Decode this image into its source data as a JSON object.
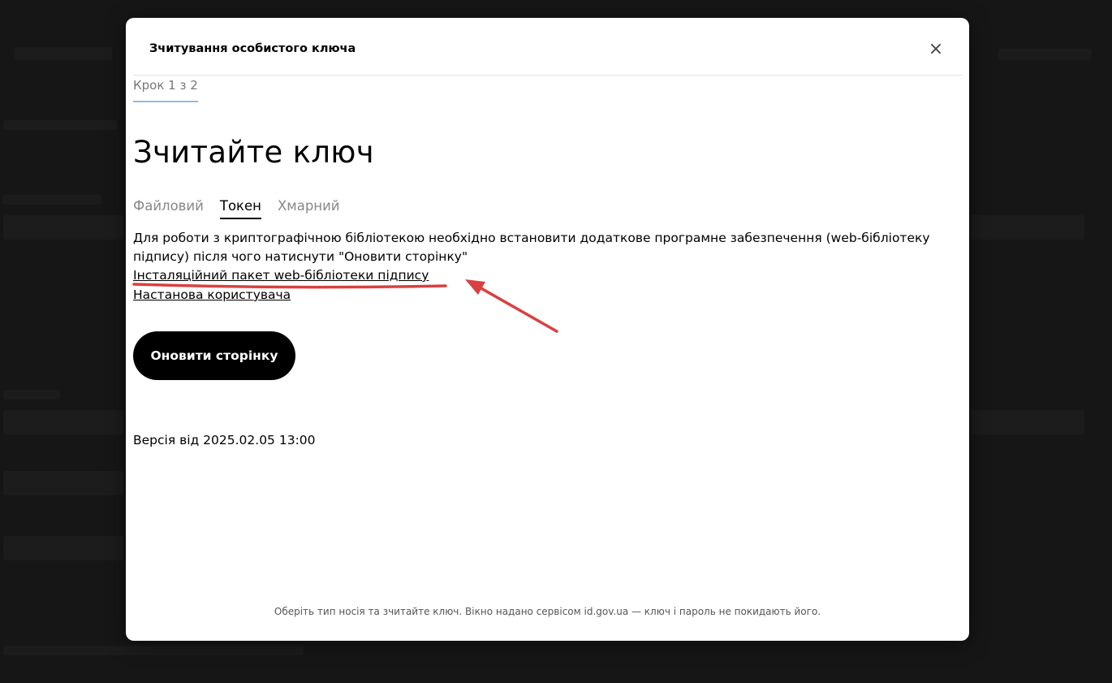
{
  "modal": {
    "title": "Зчитування особистого ключа",
    "close_symbol": "×",
    "step": "Крок 1 з 2",
    "heading": "Зчитайте ключ",
    "tabs": [
      {
        "label": "Файловий",
        "active": false
      },
      {
        "label": "Токен",
        "active": true
      },
      {
        "label": "Хмарний",
        "active": false
      }
    ],
    "description": "Для роботи з криптографічною бібліотекою необхідно встановити додаткове програмне забезпечення (web-бібліотеку підпису) після чого натиснути \"Оновити сторінку\"",
    "links": {
      "installer": "Інсталяційний пакет web-бібліотеки підпису",
      "manual": "Настанова користувача"
    },
    "refresh_button": "Оновити сторінку",
    "version": "Версія від 2025.02.05 13:00",
    "footer": "Оберіть тип носія та зчитайте ключ. Вікно надано сервісом id.gov.ua — ключ і пароль не покидають його."
  },
  "colors": {
    "annotation": "#d94040",
    "step_underline": "#93b9d6",
    "button_bg": "#000000"
  },
  "icons": {
    "close": "close-icon"
  }
}
